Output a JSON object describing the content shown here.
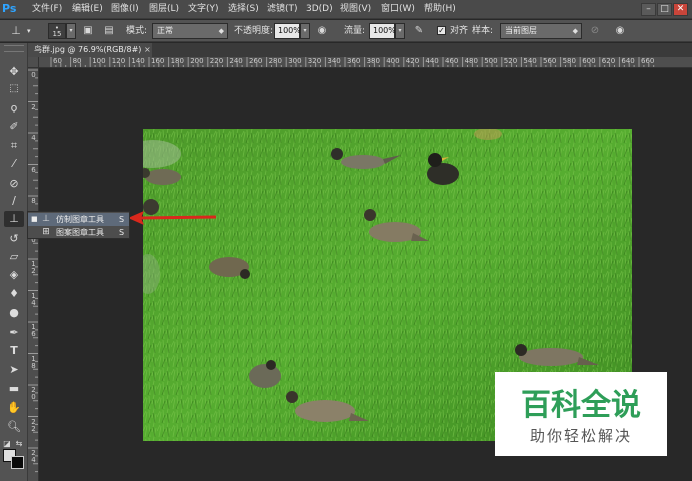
{
  "app": {
    "logo": "Ps"
  },
  "menubar": {
    "items": [
      "文件(F)",
      "编辑(E)",
      "图像(I)",
      "图层(L)",
      "文字(Y)",
      "选择(S)",
      "滤镜(T)",
      "3D(D)",
      "视图(V)",
      "窗口(W)",
      "帮助(H)"
    ],
    "window_controls": {
      "minimize": "–",
      "maximize": "□",
      "close": "✕"
    }
  },
  "options": {
    "brush_size": "15",
    "mode_label": "模式:",
    "mode_value": "正常",
    "opacity_label": "不透明度:",
    "opacity_value": "100%",
    "flow_label": "流量:",
    "flow_value": "100%",
    "align_checked": true,
    "align_label": "对齐",
    "sample_label": "样本:",
    "sample_value": "当前图层"
  },
  "document": {
    "tab_title": "鸟群.jpg @ 76.9%(RGB/8#)",
    "close_glyph": "×"
  },
  "rulers": {
    "top": [
      "60",
      "80",
      "100",
      "120",
      "140",
      "160",
      "180",
      "200",
      "220",
      "240",
      "260",
      "280",
      "300",
      "320",
      "340",
      "360",
      "380",
      "400",
      "420",
      "440",
      "460",
      "480",
      "500",
      "520",
      "540",
      "560",
      "580",
      "600",
      "620",
      "640",
      "660"
    ],
    "left": [
      "0",
      "2",
      "4",
      "6",
      "8",
      "10",
      "12",
      "14",
      "16",
      "18",
      "20",
      "22",
      "24",
      "26"
    ]
  },
  "flyout": {
    "items": [
      {
        "label": "仿制图章工具",
        "shortcut": "S",
        "selected": true,
        "icon": "clone-stamp-icon"
      },
      {
        "label": "图案图章工具",
        "shortcut": "S",
        "selected": false,
        "icon": "pattern-stamp-icon"
      }
    ]
  },
  "watermark": {
    "title": "百科全说",
    "subtitle": "助你轻松解决"
  },
  "colors": {
    "grass": "#4fa52c",
    "accent_arrow": "#d9281c",
    "watermark_green": "#2e9e58"
  }
}
